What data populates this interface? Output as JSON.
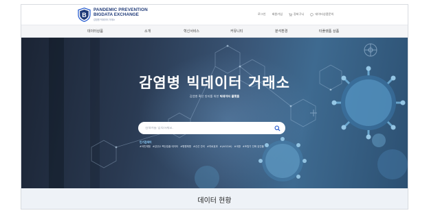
{
  "header": {
    "logo_line1": "PANDEMIC PREVENTION",
    "logo_line2": "BIGDATA EXCHANGE",
    "logo_line3": "감염병 빅데이터 거래소",
    "util": {
      "login": "로그인",
      "signup": "회원가입",
      "cart": "장바구니",
      "consult": "데이터상품문의"
    },
    "util_icons": {
      "cart": "cart-icon",
      "consult": "chat-icon"
    }
  },
  "nav": {
    "items": [
      "데이터상품",
      "소개",
      "혁신서비스",
      "커뮤니티",
      "분석환경",
      "타플랫폼 상품"
    ]
  },
  "hero": {
    "title": "감염병 빅데이터 거래소",
    "subtitle_prefix": "감염병 확산 방지를 위한 ",
    "subtitle_bold": "빅데이터 플랫폼",
    "search_placeholder": "검색어를 입력하세요.",
    "popular_label": "인기검색어",
    "popular_tags": [
      "#국민체험",
      "#감산수 핵산검출 데이터",
      "#병원체명",
      "#신선 관리",
      "#치료효과",
      "#(AOZ/AI)",
      "#국환",
      "#조립기 진짜 검진율"
    ]
  },
  "section": {
    "title": "데이터 현황"
  },
  "colors": {
    "brand": "#1f3a78",
    "accent": "#2b5fd0",
    "popular_label": "#8fd0ff"
  }
}
